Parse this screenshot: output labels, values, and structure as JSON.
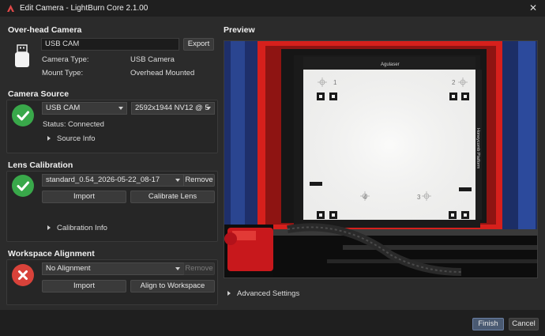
{
  "window": {
    "title": "Edit Camera - LightBurn Core 2.1.00"
  },
  "overhead": {
    "title": "Over-head Camera",
    "camera_name": "USB CAM",
    "export_label": "Export",
    "type_label": "Camera Type:",
    "type_value": "USB Camera",
    "mount_label": "Mount Type:",
    "mount_value": "Overhead Mounted"
  },
  "source": {
    "title": "Camera Source",
    "device_selected": "USB CAM",
    "resolution_selected": "2592x1944 NV12 @ 5",
    "status_label": "Status:",
    "status_value": "Connected",
    "info_label": "Source Info"
  },
  "lens": {
    "title": "Lens Calibration",
    "calibration_selected": "standard_0.54_2026-05-22_08-17",
    "remove_label": "Remove",
    "import_label": "Import",
    "calibrate_label": "Calibrate Lens",
    "info_label": "Calibration Info"
  },
  "alignment": {
    "title": "Workspace Alignment",
    "alignment_selected": "No Alignment",
    "remove_label": "Remove",
    "import_label": "Import",
    "align_label": "Align to Workspace"
  },
  "preview": {
    "title": "Preview",
    "advanced_label": "Advanced Settings",
    "scene_texts": {
      "brand": "Agulaser",
      "side": "Honeycomb Platform",
      "n1": "1",
      "n2": "2",
      "n3": "3",
      "n4": "4"
    }
  },
  "footer": {
    "finish_label": "Finish",
    "cancel_label": "Cancel"
  },
  "colors": {
    "ok": "#39a84a",
    "error": "#d8423a",
    "accent_button": "#4a5a72",
    "background": "#2b2b2b"
  }
}
